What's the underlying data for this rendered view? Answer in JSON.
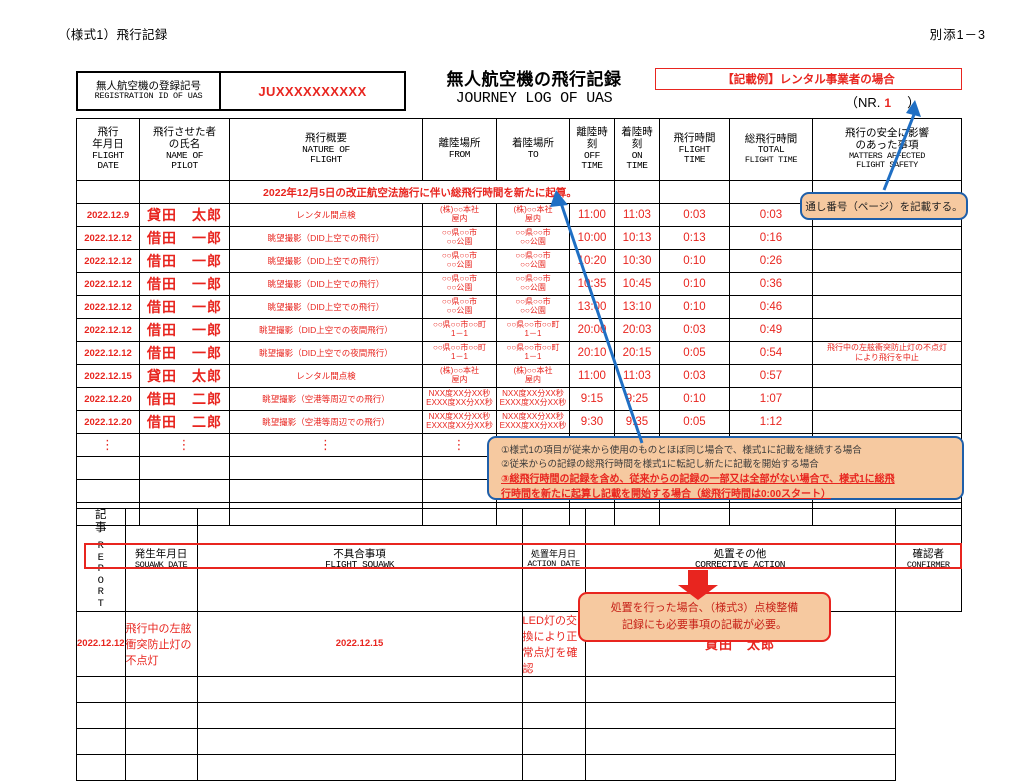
{
  "header": {
    "form_tag": "（様式1）飛行記録",
    "doc_ref": "別添1－3",
    "registration_label_jp": "無人航空機の登録記号",
    "registration_label_en": "REGISTRATION ID OF UAS",
    "registration_value": "JUXXXXXXXXXX",
    "title_jp": "無人航空機の飛行記録",
    "title_en": "JOURNEY LOG OF UAS",
    "example_note": "【記載例】レンタル事業者の場合",
    "nr_open": "（NR.",
    "nr_value": "1",
    "nr_close": "）"
  },
  "columns": [
    {
      "jp": "飛行\n年月日",
      "jp1": "飛行",
      "jp2": "年月日",
      "en1": "FLIGHT",
      "en2": "DATE"
    },
    {
      "jp1": "飛行させた者",
      "jp2": "の氏名",
      "en1": "NAME OF",
      "en2": "PILOT"
    },
    {
      "jp1": "飛行概要",
      "jp2": "",
      "en1": "NATURE OF",
      "en2": "FLIGHT"
    },
    {
      "jp1": "離陸場所",
      "jp2": "",
      "en1": "FROM",
      "en2": ""
    },
    {
      "jp1": "着陸場所",
      "jp2": "",
      "en1": "TO",
      "en2": ""
    },
    {
      "jp1": "離陸時",
      "jp2": "刻",
      "en1": "OFF",
      "en2": "TIME"
    },
    {
      "jp1": "着陸時",
      "jp2": "刻",
      "en1": "ON",
      "en2": "TIME"
    },
    {
      "jp1": "飛行時間",
      "jp2": "",
      "en1": "FLIGHT",
      "en2": "TIME"
    },
    {
      "jp1": "総飛行時間",
      "jp2": "",
      "en1": "TOTAL",
      "en2": "FLIGHT TIME"
    },
    {
      "jp1": "飛行の安全に影響",
      "jp2": "のあった事項",
      "en1": "MATTERS AFFECTED",
      "en2": "FLIGHT SAFETY"
    }
  ],
  "inline_note": "2022年12月5日の改正航空法施行に伴い総飛行時間を新たに起算。",
  "rows": [
    {
      "date": "2022.12.9",
      "pilot": "貸田　太郎",
      "nature": "レンタル間点検",
      "from1": "(株)○○本社",
      "from2": "屋内",
      "to1": "(株)○○本社",
      "to2": "屋内",
      "off": "11:00",
      "on": "11:03",
      "flight": "0:03",
      "total": "0:03",
      "safety1": "",
      "safety2": ""
    },
    {
      "date": "2022.12.12",
      "pilot": "借田　一郎",
      "nature": "眺望撮影（DID上空での飛行）",
      "from1": "○○県○○市",
      "from2": "○○公園",
      "to1": "○○県○○市",
      "to2": "○○公園",
      "off": "10:00",
      "on": "10:13",
      "flight": "0:13",
      "total": "0:16",
      "safety1": "",
      "safety2": ""
    },
    {
      "date": "2022.12.12",
      "pilot": "借田　一郎",
      "nature": "眺望撮影（DID上空での飛行）",
      "from1": "○○県○○市",
      "from2": "○○公園",
      "to1": "○○県○○市",
      "to2": "○○公園",
      "off": "10:20",
      "on": "10:30",
      "flight": "0:10",
      "total": "0:26",
      "safety1": "",
      "safety2": ""
    },
    {
      "date": "2022.12.12",
      "pilot": "借田　一郎",
      "nature": "眺望撮影（DID上空での飛行）",
      "from1": "○○県○○市",
      "from2": "○○公園",
      "to1": "○○県○○市",
      "to2": "○○公園",
      "off": "10:35",
      "on": "10:45",
      "flight": "0:10",
      "total": "0:36",
      "safety1": "",
      "safety2": ""
    },
    {
      "date": "2022.12.12",
      "pilot": "借田　一郎",
      "nature": "眺望撮影（DID上空での飛行）",
      "from1": "○○県○○市",
      "from2": "○○公園",
      "to1": "○○県○○市",
      "to2": "○○公園",
      "off": "13:00",
      "on": "13:10",
      "flight": "0:10",
      "total": "0:46",
      "safety1": "",
      "safety2": ""
    },
    {
      "date": "2022.12.12",
      "pilot": "借田　一郎",
      "nature": "眺望撮影（DID上空での夜間飛行）",
      "from1": "○○県○○市○○町",
      "from2": "1－1",
      "to1": "○○県○○市○○町",
      "to2": "1－1",
      "off": "20:00",
      "on": "20:03",
      "flight": "0:03",
      "total": "0:49",
      "safety1": "",
      "safety2": ""
    },
    {
      "date": "2022.12.12",
      "pilot": "借田　一郎",
      "nature": "眺望撮影（DID上空での夜間飛行）",
      "from1": "○○県○○市○○町",
      "from2": "1－1",
      "to1": "○○県○○市○○町",
      "to2": "1－1",
      "off": "20:10",
      "on": "20:15",
      "flight": "0:05",
      "total": "0:54",
      "safety1": "飛行中の左舷衝突防止灯の不点灯",
      "safety2": "により飛行を中止"
    },
    {
      "date": "2022.12.15",
      "pilot": "貸田　太郎",
      "nature": "レンタル間点検",
      "from1": "(株)○○本社",
      "from2": "屋内",
      "to1": "(株)○○本社",
      "to2": "屋内",
      "off": "11:00",
      "on": "11:03",
      "flight": "0:03",
      "total": "0:57",
      "safety1": "",
      "safety2": ""
    },
    {
      "date": "2022.12.20",
      "pilot": "借田　二郎",
      "nature": "眺望撮影（空港等周辺での飛行）",
      "from1": "NXX度XX分XX秒",
      "from2": "EXXX度XX分XX秒",
      "to1": "NXX度XX分XX秒",
      "to2": "EXXX度XX分XX秒",
      "off": "9:15",
      "on": "9:25",
      "flight": "0:10",
      "total": "1:07",
      "safety1": "",
      "safety2": ""
    },
    {
      "date": "2022.12.20",
      "pilot": "借田　二郎",
      "nature": "眺望撮影（空港等周辺での飛行）",
      "from1": "NXX度XX分XX秒",
      "from2": "EXXX度XX分XX秒",
      "to1": "NXX度XX分XX秒",
      "to2": "EXXX度XX分XX秒",
      "off": "9:30",
      "on": "9:35",
      "flight": "0:05",
      "total": "1:12",
      "safety1": "",
      "safety2": ""
    }
  ],
  "continuation_marker": "⋮",
  "report": {
    "side_jp1": "記",
    "side_jp2": "事",
    "side_en": "REPORT",
    "columns": [
      {
        "jp": "発生年月日",
        "en": "SQUAWK DATE"
      },
      {
        "jp": "不具合事項",
        "en": "FLIGHT SQUAWK"
      },
      {
        "jp": "処置年月日",
        "en": "ACTION DATE"
      },
      {
        "jp": "処置その他",
        "en": "CORRECTIVE ACTION"
      },
      {
        "jp": "確認者",
        "en": "CONFIRMER"
      }
    ],
    "rows": [
      {
        "squawk_date": "2022.12.12",
        "squawk": "飛行中の左舷衝突防止灯の不点灯",
        "action_date": "2022.12.15",
        "action": "LED灯の交換により正常点灯を確認",
        "confirmer": "貸田　太郎"
      }
    ],
    "blank_row_count": 4
  },
  "callouts": {
    "page_number": "通し番号（ページ）を記載する。",
    "cases_line1": "①様式1の項目が従来から使用のものとほぼ同じ場合で、様式1に記載を継続する場合",
    "cases_line2": "②従来からの記録の総飛行時間を様式1に転記し新たに記載を開始する場合",
    "cases_line3a": "③総飛行時間の記録を含め、従来からの記録の一部又は全部がない場合で、様式1に総飛",
    "cases_line3b": "行時間を新たに起算し記載を開始する場合（総飛行時間は0:00スタート）",
    "action_line1": "処置を行った場合、（様式3）点検整備",
    "action_line2": "記録にも必要事項の記載が必要。"
  },
  "colors": {
    "red_ink": "#e8251f",
    "callout_fill": "#f6c9a0",
    "callout_blue_border": "#1f5fa9",
    "arrow_blue": "#1f6fc4",
    "arrow_red": "#e8251f"
  }
}
